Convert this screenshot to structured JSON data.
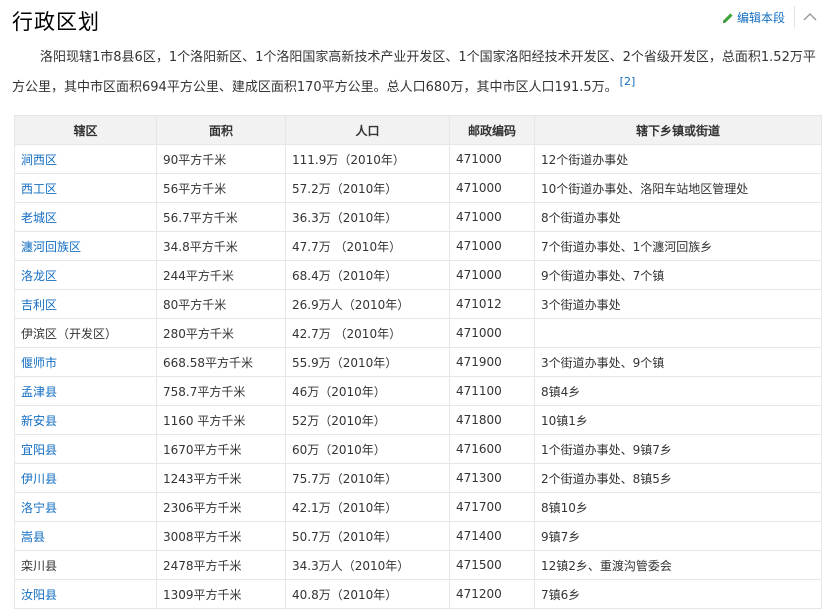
{
  "section": {
    "title": "行政区划",
    "edit_label": "编辑本段"
  },
  "intro": {
    "text": "洛阳现辖1市8县6区，1个洛阳新区、1个洛阳国家高新技术产业开发区、1个国家洛阳经技术开发区、2个省级开发区，总面积1.52万平方公里，其中市区面积694平方公里、建成区面积170平方公里。总人口680万，其中市区人口191.5万。",
    "ref": "[2]"
  },
  "table": {
    "headers": [
      "辖区",
      "面积",
      "人口",
      "邮政编码",
      "辖下乡镇或街道"
    ],
    "rows": [
      {
        "name": "涧西区",
        "link": true,
        "area": "90平方千米",
        "population": "111.9万（2010年）",
        "postcode": "471000",
        "subdivisions": "12个街道办事处"
      },
      {
        "name": "西工区",
        "link": true,
        "area": "56平方千米",
        "population": "57.2万（2010年）",
        "postcode": "471000",
        "subdivisions": "10个街道办事处、洛阳车站地区管理处"
      },
      {
        "name": "老城区",
        "link": true,
        "area": "56.7平方千米",
        "population": "36.3万（2010年）",
        "postcode": "471000",
        "subdivisions": "8个街道办事处"
      },
      {
        "name": "瀍河回族区",
        "link": true,
        "area": "34.8平方千米",
        "population": "47.7万 （2010年）",
        "postcode": "471000",
        "subdivisions": "7个街道办事处、1个瀍河回族乡"
      },
      {
        "name": "洛龙区",
        "link": true,
        "area": "244平方千米",
        "population": "68.4万（2010年）",
        "postcode": "471000",
        "subdivisions": "9个街道办事处、7个镇"
      },
      {
        "name": "吉利区",
        "link": true,
        "area": "80平方千米",
        "population": "26.9万人（2010年）",
        "postcode": "471012",
        "subdivisions": "3个街道办事处"
      },
      {
        "name": "伊滨区（开发区）",
        "link": false,
        "area": "280平方千米",
        "population": "42.7万 （2010年）",
        "postcode": "471000",
        "subdivisions": ""
      },
      {
        "name": "偃师市",
        "link": true,
        "area": "668.58平方千米",
        "population": "55.9万（2010年）",
        "postcode": "471900",
        "subdivisions": "3个街道办事处、9个镇"
      },
      {
        "name": "孟津县",
        "link": true,
        "area": "758.7平方千米",
        "population": "46万（2010年）",
        "postcode": "471100",
        "subdivisions": "8镇4乡"
      },
      {
        "name": "新安县",
        "link": true,
        "area": "1160 平方千米",
        "population": "52万（2010年）",
        "postcode": "471800",
        "subdivisions": "10镇1乡"
      },
      {
        "name": "宜阳县",
        "link": true,
        "area": "1670平方千米",
        "population": "60万（2010年）",
        "postcode": "471600",
        "subdivisions": "1个街道办事处、9镇7乡"
      },
      {
        "name": "伊川县",
        "link": true,
        "area": "1243平方千米",
        "population": "75.7万（2010年）",
        "postcode": "471300",
        "subdivisions": "2个街道办事处、8镇5乡"
      },
      {
        "name": "洛宁县",
        "link": true,
        "area": "2306平方千米",
        "population": "42.1万（2010年）",
        "postcode": "471700",
        "subdivisions": "8镇10乡"
      },
      {
        "name": "嵩县",
        "link": true,
        "area": "3008平方千米",
        "population": "50.7万（2010年）",
        "postcode": "471400",
        "subdivisions": "9镇7乡"
      },
      {
        "name": "栾川县",
        "link": false,
        "area": "2478平方千米",
        "population": "34.3万人（2010年）",
        "postcode": "471500",
        "subdivisions": "12镇2乡、重渡沟管委会"
      },
      {
        "name": "汝阳县",
        "link": true,
        "area": "1309平方千米",
        "population": "40.8万（2010年）",
        "postcode": "471200",
        "subdivisions": "7镇6乡"
      }
    ]
  },
  "colors": {
    "link": "#136ec2",
    "edit_pen": "#3fa33a",
    "header_bg": "#f2f2f2",
    "border": "#e6e6e6"
  },
  "icons": {
    "edit": "pencil-icon",
    "collapse": "chevron-up-icon"
  }
}
